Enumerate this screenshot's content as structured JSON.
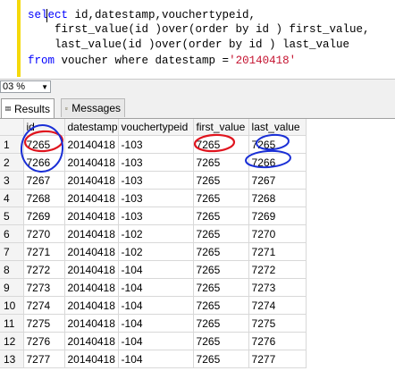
{
  "editor": {
    "line1_kw": "select",
    "line1_rest": " id,datestamp,vouchertypeid,",
    "line2": "    first_value(id )over(order by id ) first_value,",
    "line3": "    last_value(id )over(order by id ) last_value",
    "line4_kw": "from",
    "line4_rest": " voucher where datestamp =",
    "line4_str": "'20140418'"
  },
  "zoom": {
    "value": "03 %"
  },
  "tabs": [
    {
      "label": "Results",
      "icon": "grid-icon"
    },
    {
      "label": "Messages",
      "icon": "messages-icon"
    }
  ],
  "results": {
    "columns": [
      "id",
      "datestamp",
      "vouchertypeid",
      "first_value",
      "last_value"
    ],
    "rows": [
      [
        "1",
        "7265",
        "20140418",
        "-103",
        "7265",
        "7265"
      ],
      [
        "2",
        "7266",
        "20140418",
        "-103",
        "7265",
        "7266"
      ],
      [
        "3",
        "7267",
        "20140418",
        "-103",
        "7265",
        "7267"
      ],
      [
        "4",
        "7268",
        "20140418",
        "-103",
        "7265",
        "7268"
      ],
      [
        "5",
        "7269",
        "20140418",
        "-103",
        "7265",
        "7269"
      ],
      [
        "6",
        "7270",
        "20140418",
        "-102",
        "7265",
        "7270"
      ],
      [
        "7",
        "7271",
        "20140418",
        "-102",
        "7265",
        "7271"
      ],
      [
        "8",
        "7272",
        "20140418",
        "-104",
        "7265",
        "7272"
      ],
      [
        "9",
        "7273",
        "20140418",
        "-104",
        "7265",
        "7273"
      ],
      [
        "10",
        "7274",
        "20140418",
        "-104",
        "7265",
        "7274"
      ],
      [
        "11",
        "7275",
        "20140418",
        "-104",
        "7265",
        "7275"
      ],
      [
        "12",
        "7276",
        "20140418",
        "-104",
        "7265",
        "7276"
      ],
      [
        "13",
        "7277",
        "20140418",
        "-104",
        "7265",
        "7277"
      ]
    ]
  },
  "annotations": {
    "blue": "#1a2fd6",
    "red": "#e0141e"
  }
}
